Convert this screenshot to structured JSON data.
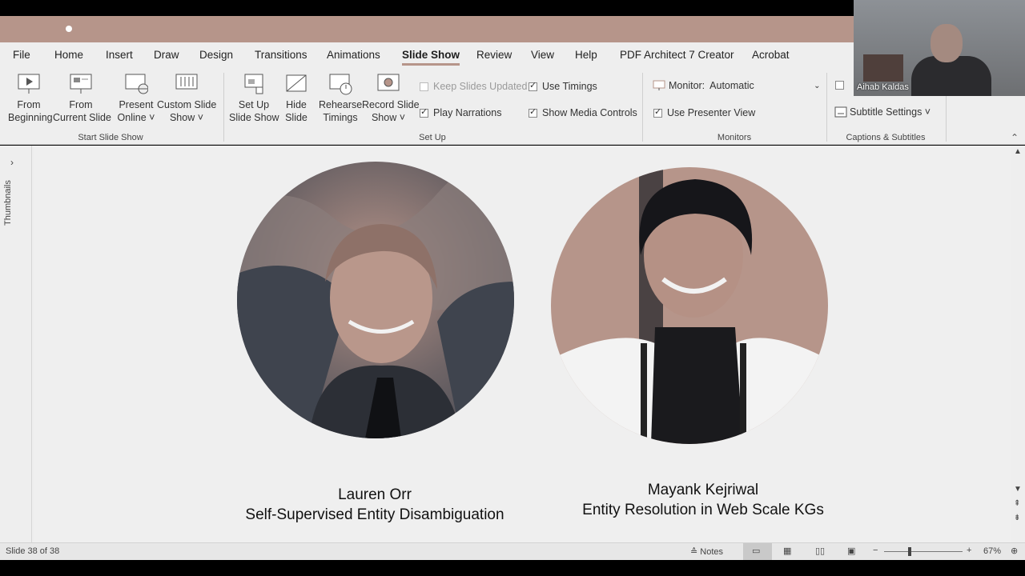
{
  "menu": {
    "tabs": [
      "File",
      "Home",
      "Insert",
      "Draw",
      "Design",
      "Transitions",
      "Animations",
      "Slide Show",
      "Review",
      "View",
      "Help",
      "PDF Architect 7 Creator",
      "Acrobat"
    ],
    "active_tab": "Slide Show"
  },
  "ribbon": {
    "start": {
      "from_beginning": [
        "From",
        "Beginning"
      ],
      "from_current": [
        "From",
        "Current Slide"
      ],
      "present_online": [
        "Present",
        "Online ˅"
      ],
      "custom_show": [
        "Custom Slide",
        "Show ˅"
      ],
      "group_label": "Start Slide Show"
    },
    "setup": {
      "setup_show": [
        "Set Up",
        "Slide Show"
      ],
      "hide_slide": [
        "Hide",
        "Slide"
      ],
      "rehearse": [
        "Rehearse",
        "Timings"
      ],
      "record": [
        "Record Slide",
        "Show ˅"
      ],
      "keep_updated": "Keep Slides Updated",
      "play_narrations": "Play Narrations",
      "use_timings": "Use Timings",
      "show_media_controls": "Show Media Controls",
      "group_label": "Set Up"
    },
    "monitors": {
      "monitor_label": "Monitor:",
      "monitor_value": "Automatic",
      "use_presenter_view": "Use Presenter View",
      "group_label": "Monitors"
    },
    "captions": {
      "subtitle_settings": "Subtitle Settings ˅",
      "group_label": "Captions & Subtitles"
    }
  },
  "webcam": {
    "name": "Aihab Kaldas"
  },
  "sidebar": {
    "label": "Thumbnails"
  },
  "slide": {
    "left": {
      "name": "Lauren Orr",
      "title": "Self-Supervised Entity Disambiguation"
    },
    "right": {
      "name": "Mayank Kejriwal",
      "title": "Entity Resolution in Web Scale KGs"
    }
  },
  "status": {
    "slide_counter": "Slide 38 of 38",
    "notes": "Notes",
    "zoom": "67%"
  },
  "colors": {
    "accent": "#b6958a",
    "background": "#eeeeee"
  }
}
